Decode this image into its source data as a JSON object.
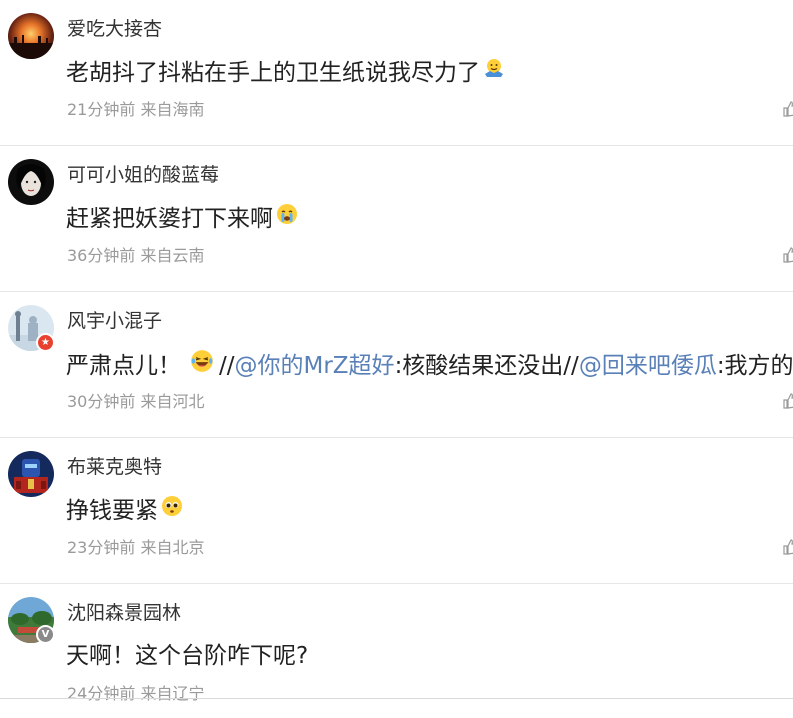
{
  "comments": [
    {
      "username": "爱吃大接杏",
      "text": "老胡抖了抖粘在手上的卫生纸说我尽力了",
      "emoji": "shrug-emoji",
      "time": "21分钟前",
      "location": "来自海南"
    },
    {
      "username": "可可小姐的酸蓝莓",
      "text": "赶紧把妖婆打下来啊",
      "emoji": "crying-emoji",
      "time": "36分钟前",
      "location": "来自云南"
    },
    {
      "username": "风宇小混子",
      "text_parts": [
        "严肃点儿！",
        " //",
        "@你的MrZ超好",
        ":核酸结果还没出//",
        "@回来吧倭瓜",
        ":我方的"
      ],
      "emoji": "laughing-tears-emoji",
      "time": "30分钟前",
      "location": "来自河北"
    },
    {
      "username": "布莱克奥特",
      "text": "挣钱要紧",
      "emoji": "pleading-emoji",
      "time": "23分钟前",
      "location": "来自北京"
    },
    {
      "username": "沈阳森景园林",
      "text": "天啊！这个台阶咋下呢?",
      "time": "24分钟前",
      "location": "来自辽宁"
    }
  ],
  "colors": {
    "link": "#5a80b8",
    "meta": "#9a9a9a",
    "divider": "#e6e6e6",
    "verified_red": "#e8412f",
    "verified_gray": "#8a8a8a"
  }
}
